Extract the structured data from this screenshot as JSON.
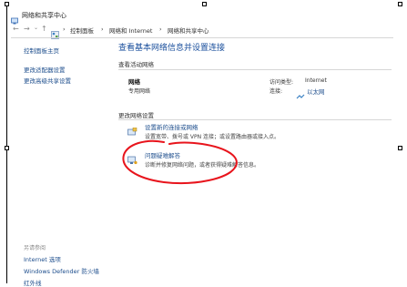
{
  "window": {
    "title": "网络和共享中心",
    "breadcrumb": [
      "控制面板",
      "网络和 Internet",
      "网络和共享中心"
    ],
    "breadcrumb_sep": "›"
  },
  "sidebar": {
    "items": [
      {
        "label": "控制面板主页"
      },
      {
        "label": "更改适配器设置"
      },
      {
        "label": "更改高级共享设置"
      }
    ],
    "see_also_label": "另请参阅",
    "see_also": [
      {
        "label": "Internet 选项"
      },
      {
        "label": "Windows Defender 防火墙"
      },
      {
        "label": "红外线"
      }
    ]
  },
  "main": {
    "title": "查看基本网络信息并设置连接",
    "active_networks_label": "查看活动网络",
    "network": {
      "name": "网络",
      "type": "专用网络",
      "access_type_label": "访问类型:",
      "access_type_value": "Internet",
      "connections_label": "连接:",
      "connections_value": "以太网"
    },
    "change_settings_label": "更改网络设置",
    "options": [
      {
        "title": "设置新的连接或网络",
        "desc": "设置宽带、拨号或 VPN 连接；或设置路由器或接入点。"
      },
      {
        "title": "问题疑难解答",
        "desc": "诊断并修复网络问题，或者获得疑难解答信息。"
      }
    ]
  },
  "colors": {
    "link": "#1c4d8c",
    "title": "#1a4f9c",
    "annotation": "#e8141c"
  },
  "icons": [
    "back-arrow-icon",
    "forward-arrow-icon",
    "up-arrow-icon",
    "control-panel-icon",
    "network-share-icon",
    "ethernet-icon",
    "new-connection-icon",
    "troubleshoot-icon"
  ]
}
